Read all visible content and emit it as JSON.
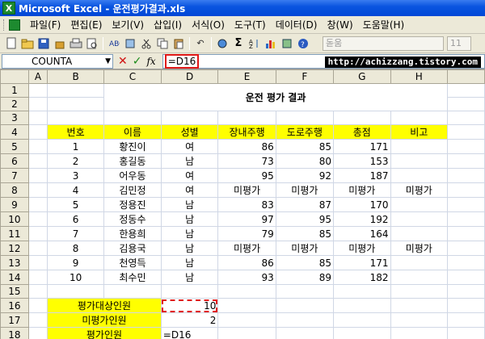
{
  "window": {
    "title": "Microsoft Excel - 운전평가결과.xls",
    "app_icon": "X"
  },
  "menu": {
    "items": [
      "파일(F)",
      "편집(E)",
      "보기(V)",
      "삽입(I)",
      "서식(O)",
      "도구(T)",
      "데이터(D)",
      "창(W)",
      "도움말(H)"
    ]
  },
  "toolbar": {
    "font_value": "돋움",
    "size_value": "11",
    "sigma": "Σ",
    "undo": "↶"
  },
  "formula_bar": {
    "name_box": "COUNTA",
    "formula": "=D16",
    "cancel": "✕",
    "enter": "✓",
    "fx": "fx",
    "watermark": "http://achizzang.tistory.com"
  },
  "sheet": {
    "columns": [
      "A",
      "B",
      "C",
      "D",
      "E",
      "F",
      "G",
      "H"
    ],
    "rows": [
      "1",
      "2",
      "3",
      "4",
      "5",
      "6",
      "7",
      "8",
      "9",
      "10",
      "11",
      "12",
      "13",
      "14",
      "15",
      "16",
      "17",
      "18"
    ],
    "title": "운전 평가 결과",
    "headers": [
      "번호",
      "이름",
      "성별",
      "장내주행",
      "도로주행",
      "총점",
      "비고"
    ],
    "data": [
      [
        "1",
        "황진이",
        "여",
        "86",
        "85",
        "171",
        ""
      ],
      [
        "2",
        "홍길동",
        "남",
        "73",
        "80",
        "153",
        ""
      ],
      [
        "3",
        "어우동",
        "여",
        "95",
        "92",
        "187",
        ""
      ],
      [
        "4",
        "김민정",
        "여",
        "미평가",
        "미평가",
        "미평가",
        "미평가"
      ],
      [
        "5",
        "정용진",
        "남",
        "83",
        "87",
        "170",
        ""
      ],
      [
        "6",
        "정동수",
        "남",
        "97",
        "95",
        "192",
        ""
      ],
      [
        "7",
        "한용희",
        "남",
        "79",
        "85",
        "164",
        ""
      ],
      [
        "8",
        "김용국",
        "남",
        "미평가",
        "미평가",
        "미평가",
        "미평가"
      ],
      [
        "9",
        "천영득",
        "남",
        "86",
        "85",
        "171",
        ""
      ],
      [
        "10",
        "최수민",
        "남",
        "93",
        "89",
        "182",
        ""
      ]
    ],
    "summary": [
      {
        "label": "평가대상인원",
        "value": "10"
      },
      {
        "label": "미평가인원",
        "value": "2"
      },
      {
        "label": "평가인원",
        "value": "=D16"
      }
    ]
  }
}
